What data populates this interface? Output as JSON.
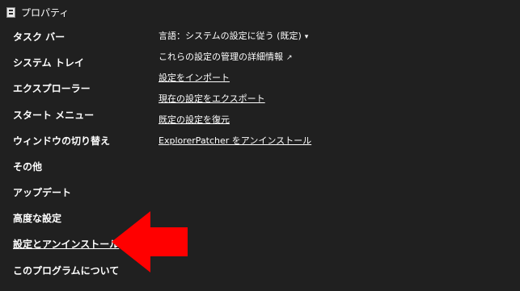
{
  "window": {
    "title": "プロパティ"
  },
  "sidebar": {
    "items": [
      {
        "label": "タスク バー"
      },
      {
        "label": "システム トレイ"
      },
      {
        "label": "エクスプローラー"
      },
      {
        "label": "スタート メニュー"
      },
      {
        "label": "ウィンドウの切り替え"
      },
      {
        "label": "その他"
      },
      {
        "label": "アップデート"
      },
      {
        "label": "高度な設定"
      },
      {
        "label": "設定とアンインストール"
      },
      {
        "label": "このプログラムについて"
      }
    ]
  },
  "main": {
    "language_label": "言語：システムの設定に従う (既定)",
    "language_arrow": "▾",
    "manage_link": "これらの設定の管理の詳細情報",
    "manage_arrow": "↗",
    "import": "設定をインポート",
    "export": "現在の設定をエクスポート",
    "restore": "既定の設定を復元",
    "uninstall": "ExplorerPatcher をアンインストール"
  },
  "annotation": {
    "color": "#ff0000"
  }
}
